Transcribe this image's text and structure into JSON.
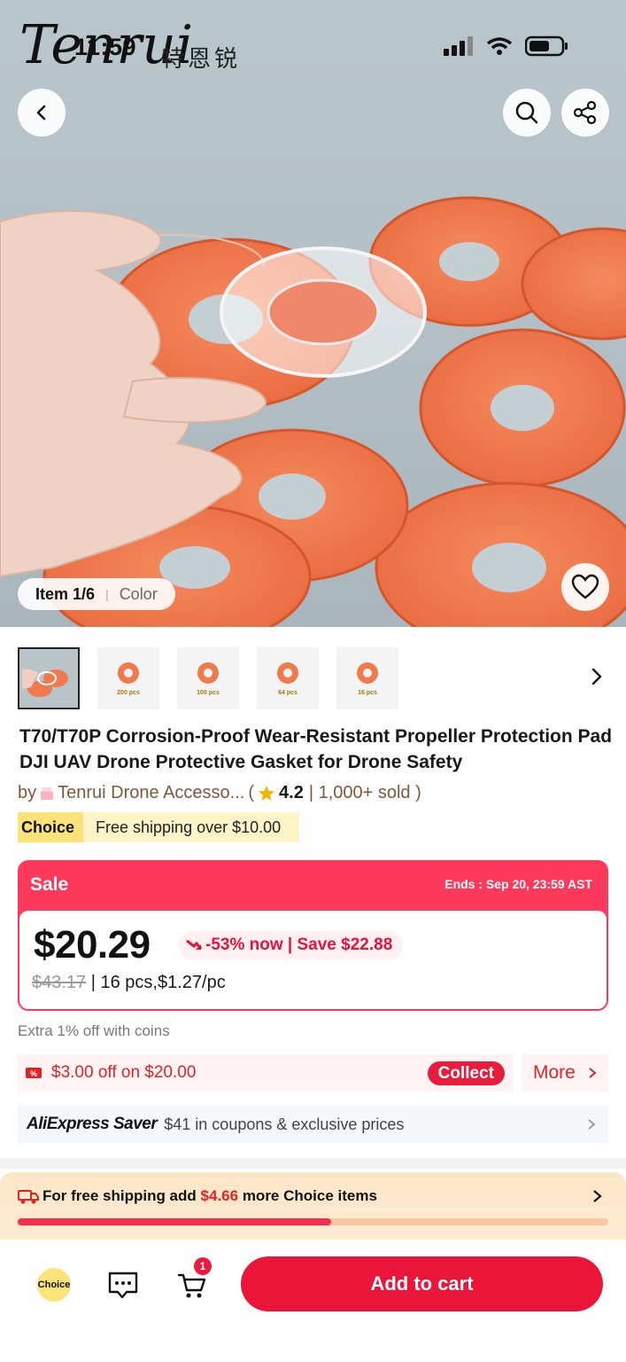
{
  "status_bar": {
    "time": "11:59"
  },
  "watermark": {
    "brand_script": "Tenrui",
    "brand_cn": "特恩锐"
  },
  "gallery": {
    "position": "Item 1/6",
    "variant_label": "Color"
  },
  "thumbnails": [
    {
      "label": ""
    },
    {
      "label": "200 pcs"
    },
    {
      "label": "100 pcs"
    },
    {
      "label": "64 pcs"
    },
    {
      "label": "16 pcs"
    }
  ],
  "product": {
    "title": "T70/T70P Corrosion-Proof Wear-Resistant Propeller Protection Pad DJI UAV Drone Protective Gasket for Drone Safety",
    "by": "by",
    "store": "Tenrui Drone Accesso...",
    "rating": "4.2",
    "sold": "| 1,000+ sold )",
    "open_paren": "("
  },
  "choice": {
    "tag": "Choice",
    "shipping": "Free shipping over $10.00"
  },
  "sale": {
    "label": "Sale",
    "ends": "Ends : Sep 20, 23:59 AST",
    "price": "$20.29",
    "discount": "-53% now | Save $22.88",
    "old_price": "$43.17",
    "unit_info": "| 16 pcs,$1.27/pc"
  },
  "coins_note": "Extra 1% off with coins",
  "coupon": {
    "text": "$3.00 off on $20.00",
    "collect": "Collect",
    "more": "More"
  },
  "saver": {
    "logo": "AliExpress Saver",
    "text": "$41 in coupons & exclusive prices"
  },
  "shipping_banner": {
    "prefix": "For free shipping add",
    "amount": "$4.66",
    "suffix": "more Choice items",
    "progress": 0.53
  },
  "bottom_bar": {
    "choice_label": "Choice",
    "cart_count": "1",
    "add_to_cart": "Add to cart"
  },
  "colors": {
    "accent": "#ea1538",
    "sale": "#fd3a5b",
    "choice_yellow": "#fbe37a",
    "product_orange": "#f07a4e"
  }
}
